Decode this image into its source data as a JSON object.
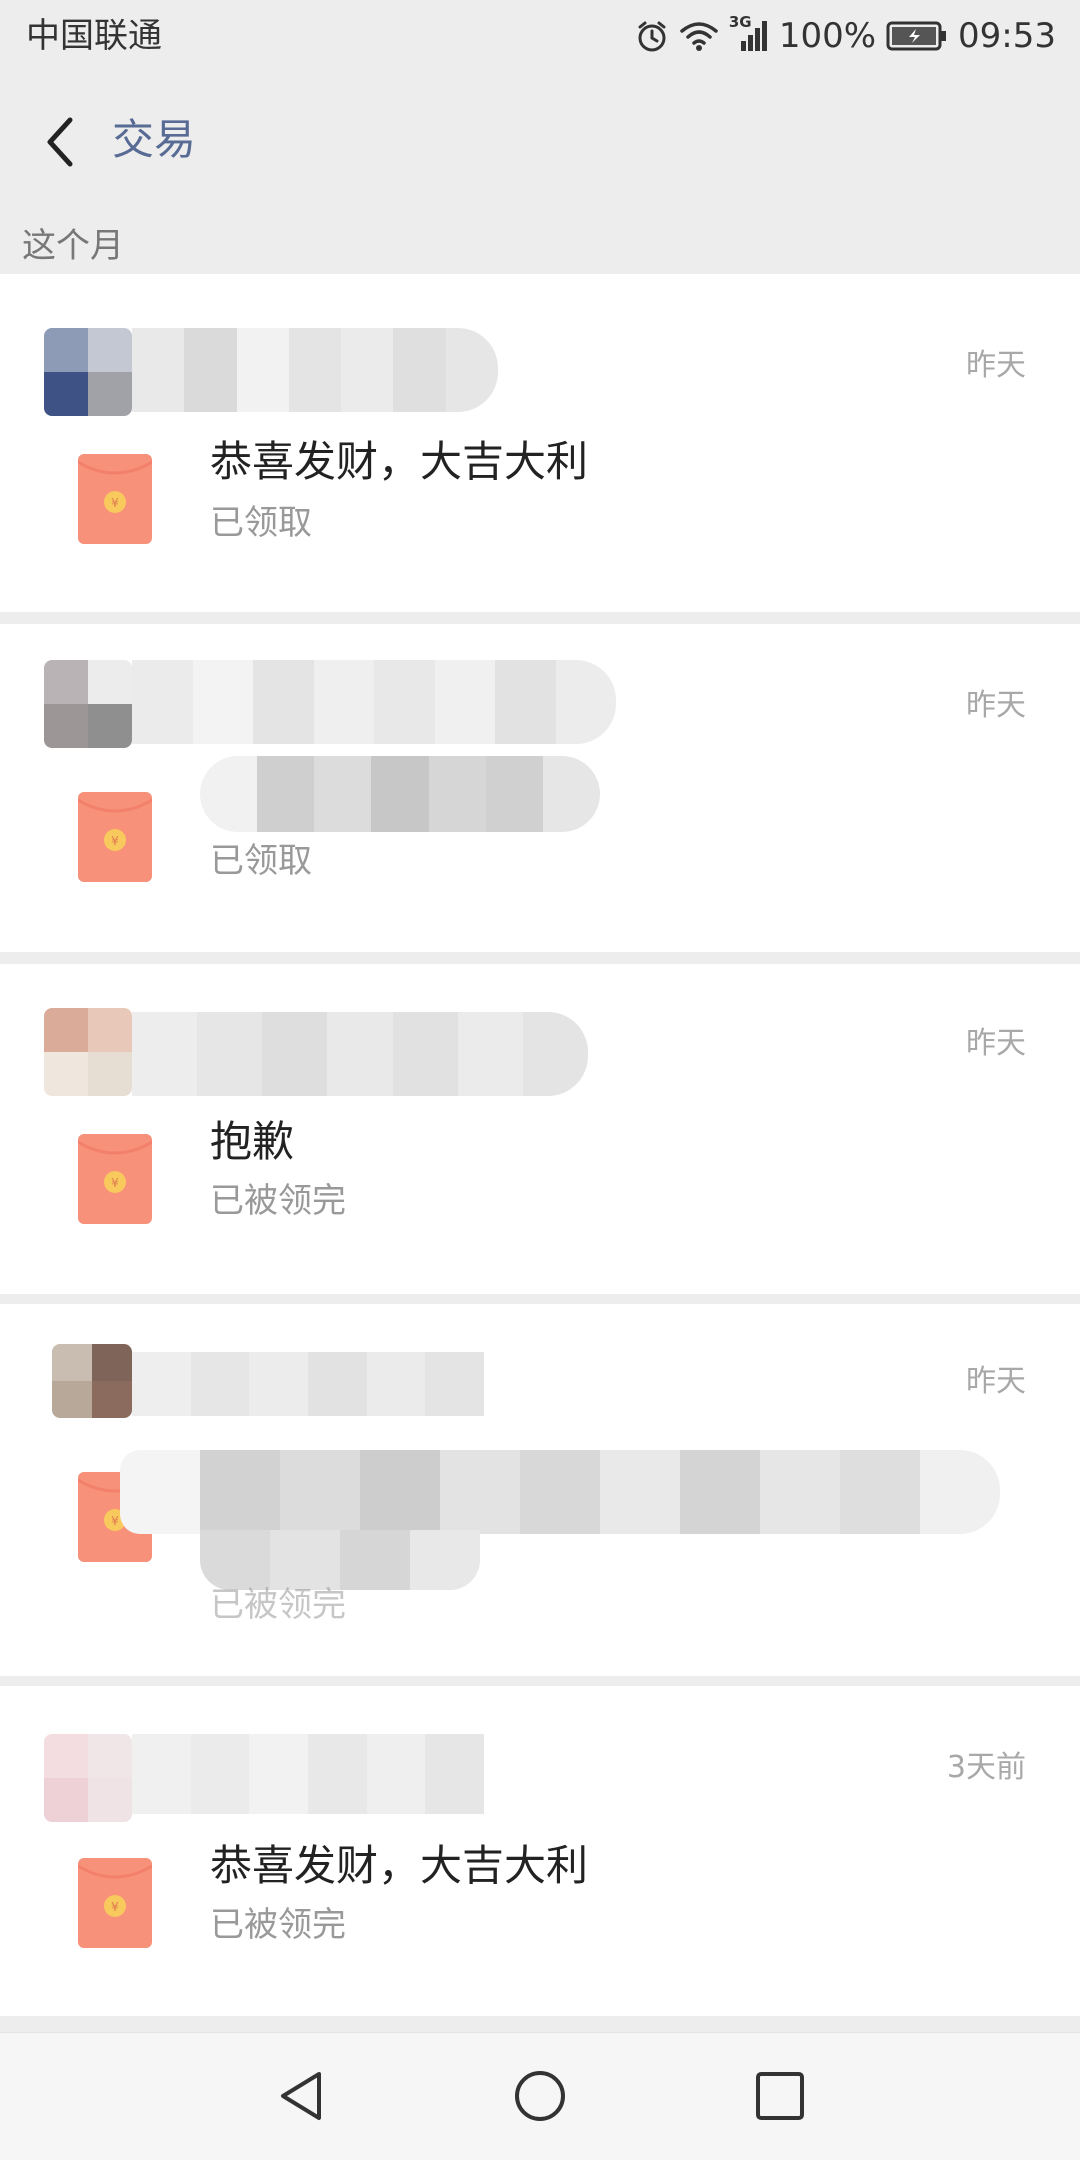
{
  "status_bar": {
    "carrier": "中国联通",
    "network": "3G",
    "battery": "100%",
    "time": "09:53"
  },
  "header": {
    "title": "交易"
  },
  "section": {
    "label": "这个月"
  },
  "transactions": [
    {
      "time": "昨天",
      "message": "恭喜发财，大吉大利",
      "status": "已领取"
    },
    {
      "time": "昨天",
      "message": "",
      "status": "已领取"
    },
    {
      "time": "昨天",
      "message": "抱歉",
      "status": "已被领完"
    },
    {
      "time": "昨天",
      "message": "",
      "status": "已被领完"
    },
    {
      "time": "3天前",
      "message": "恭喜发财，大吉大利",
      "status": "已被领完"
    }
  ],
  "icons": {
    "envelope": "red-envelope-icon",
    "back": "chevron-left-icon",
    "nav_back": "triangle-back-icon",
    "nav_home": "circle-home-icon",
    "nav_recent": "square-recent-icon"
  },
  "colors": {
    "title": "#576b95",
    "envelope": "#f7917a",
    "background": "#ededed"
  }
}
